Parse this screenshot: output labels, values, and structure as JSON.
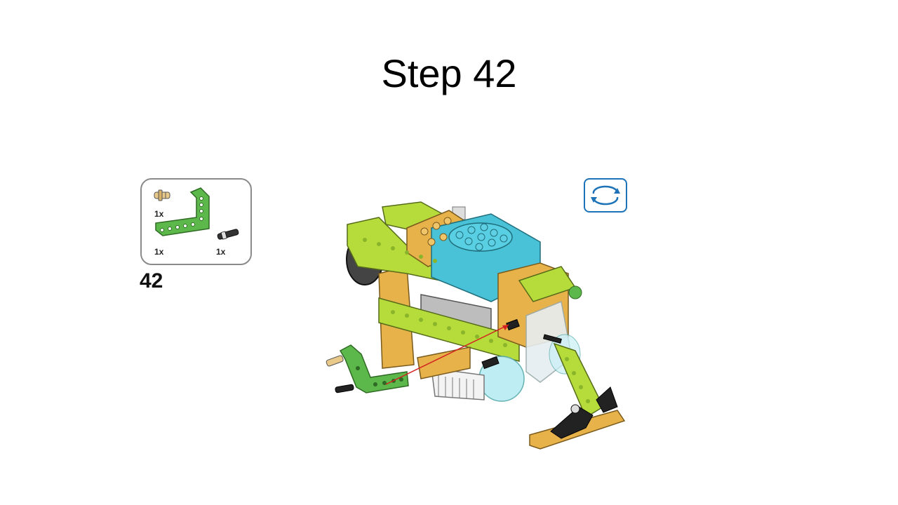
{
  "title": "Step 42",
  "step_number": "42",
  "parts": [
    {
      "qty": "1x",
      "name": "tan-connector-pin"
    },
    {
      "qty": "1x",
      "name": "green-l-beam"
    },
    {
      "qty": "1x",
      "name": "black-axle-pin"
    }
  ],
  "controls": {
    "rotate_icon": "rotate-view-icon"
  },
  "colors": {
    "lime": "#b5dc3a",
    "green": "#5cb84a",
    "tan": "#e8b24a",
    "cyan": "#49c1d6",
    "accent_blue": "#1e73b8"
  }
}
